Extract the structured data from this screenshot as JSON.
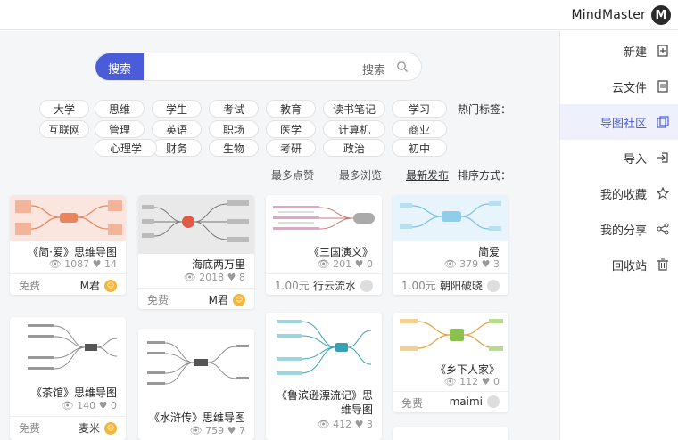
{
  "app": {
    "brand": "MindMaster",
    "brand_logo_letter": "M"
  },
  "sidebar": {
    "items": [
      {
        "label": "新建",
        "icon": "new-file-icon"
      },
      {
        "label": "云文件",
        "icon": "cloud-file-icon"
      },
      {
        "label": "导图社区",
        "icon": "community-icon",
        "active": true
      },
      {
        "label": "导入",
        "icon": "import-icon"
      },
      {
        "label": "我的收藏",
        "icon": "star-icon"
      },
      {
        "label": "我的分享",
        "icon": "share-icon"
      },
      {
        "label": "回收站",
        "icon": "trash-icon"
      }
    ]
  },
  "search": {
    "button": "搜索",
    "placeholder": "搜索"
  },
  "tags": {
    "label": "热门标签：",
    "items": [
      "学习",
      "读书笔记",
      "教育",
      "考试",
      "学生",
      "思维",
      "大学",
      "商业",
      "计算机",
      "医学",
      "职场",
      "英语",
      "管理",
      "互联网",
      "初中",
      "政治",
      "考研",
      "生物",
      "财务",
      "心理学"
    ]
  },
  "sort": {
    "label": "排序方式：",
    "options": [
      "最新发布",
      "最多浏览",
      "最多点赞"
    ],
    "active": 0
  },
  "cards": [
    {
      "title": "简爱",
      "views": "379",
      "likes": "3",
      "author": "朝阳破晓",
      "price": "1.00元"
    },
    {
      "title": "《三国演义》",
      "views": "201",
      "likes": "0",
      "author": "行云流水",
      "price": "1.00元"
    },
    {
      "title": "海底两万里",
      "views": "2018",
      "likes": "8",
      "author": "M君",
      "price": "免费"
    },
    {
      "title": "《简·爱》思维导图",
      "views": "1087",
      "likes": "14",
      "author": "M君",
      "price": "免费"
    },
    {
      "title": "《乡下人家》",
      "views": "112",
      "likes": "0",
      "author": "maimi",
      "price": "免费"
    },
    {
      "title": "《鲁滨逊漂流记》思维导图",
      "views": "412",
      "likes": "3",
      "author": "",
      "price": ""
    },
    {
      "title": "《水浒传》思维导图",
      "views": "759",
      "likes": "7",
      "author": "",
      "price": ""
    },
    {
      "title": "《茶馆》思维导图",
      "views": "140",
      "likes": "0",
      "author": "麦米",
      "price": "免费"
    }
  ]
}
